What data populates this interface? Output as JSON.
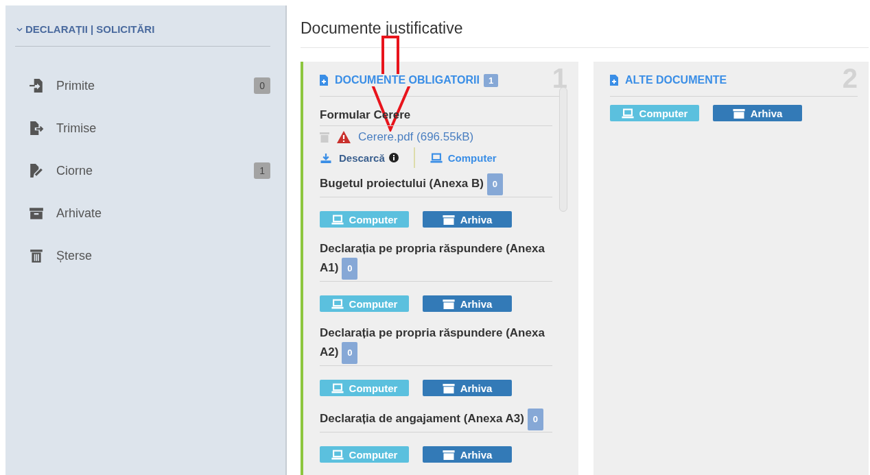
{
  "sidebar": {
    "heading": "DECLARAȚII | SOLICITĂRI",
    "expanded": true,
    "items": [
      {
        "kind": "inbox",
        "label": "Primite",
        "count": "0"
      },
      {
        "kind": "sent",
        "label": "Trimise"
      },
      {
        "kind": "draft",
        "label": "Ciorne",
        "count": "1"
      },
      {
        "kind": "archive",
        "label": "Arhivate"
      },
      {
        "kind": "trash",
        "label": "Șterse"
      }
    ]
  },
  "main": {
    "title": "Documente justificative",
    "panels": [
      {
        "title": "DOCUMENTE OBLIGATORII",
        "count": "1",
        "number": "1",
        "highlighted": true,
        "documents": [
          {
            "kind": "file",
            "title": "Formular Cerere",
            "file": "Cerere.pdf (696.55kB)",
            "download": "Descarcă",
            "computer": "Computer"
          },
          {
            "kind": "upload",
            "title": "Bugetul proiectului (Anexa B)",
            "count": "0",
            "computer": "Computer",
            "archive": "Arhiva"
          },
          {
            "kind": "upload",
            "title": "Declarația pe propria răspundere (Anexa A1)",
            "count": "0",
            "computer": "Computer",
            "archive": "Arhiva"
          },
          {
            "kind": "upload",
            "title": "Declarația pe propria răspundere (Anexa A2)",
            "count": "0",
            "computer": "Computer",
            "archive": "Arhiva"
          },
          {
            "kind": "upload",
            "title": "Declarația de angajament (Anexa A3)",
            "count": "0",
            "computer": "Computer",
            "archive": "Arhiva"
          }
        ]
      },
      {
        "title": "ALTE DOCUMENTE",
        "number": "2",
        "highlighted": false,
        "computer": "Computer",
        "archive": "Arhiva"
      }
    ]
  }
}
